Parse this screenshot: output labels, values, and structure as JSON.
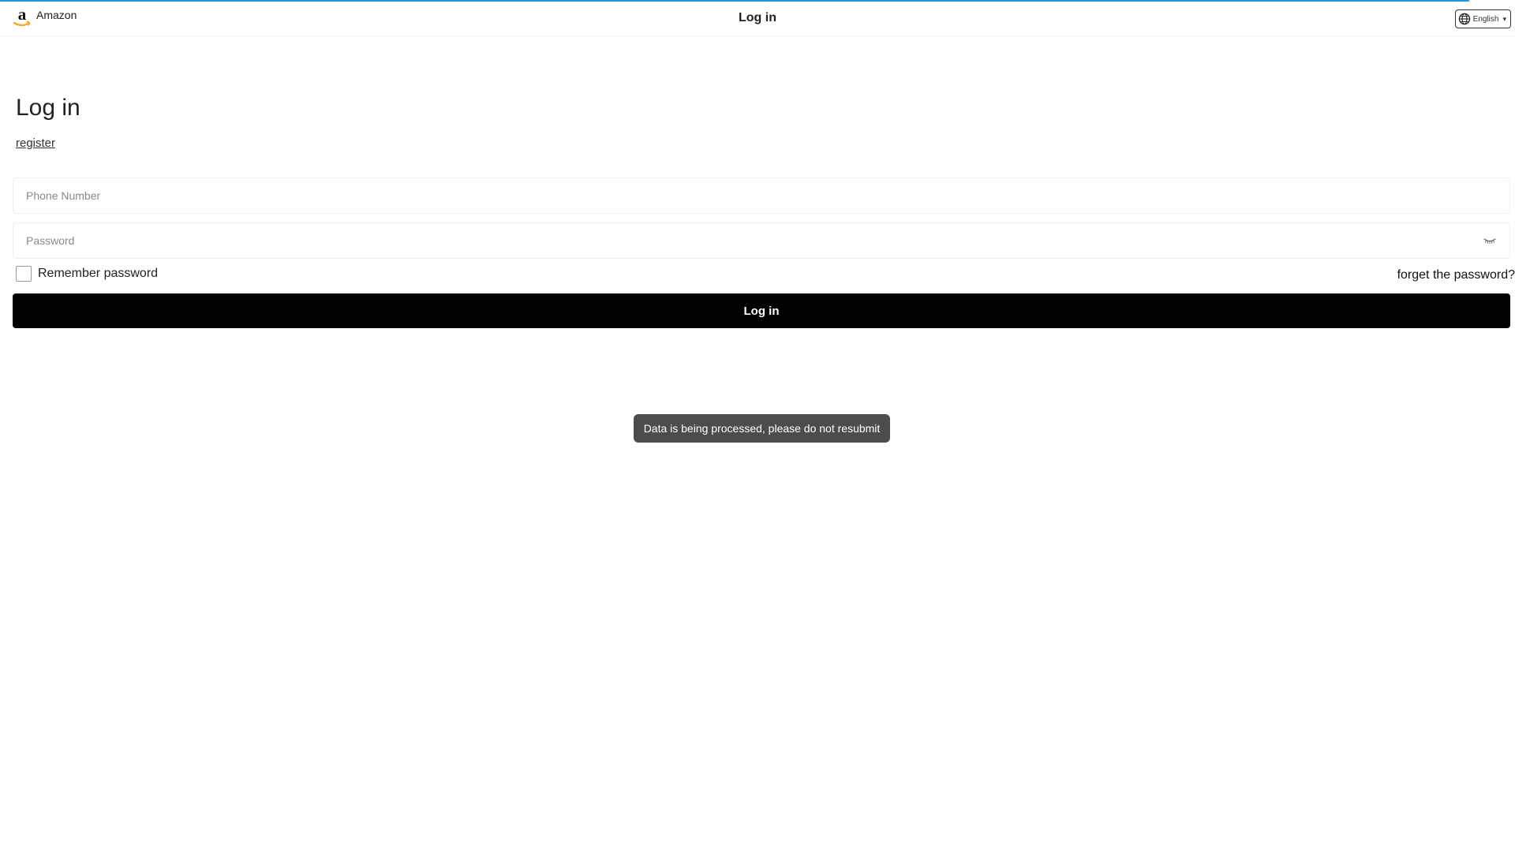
{
  "loading": {
    "progress": 0.97,
    "color": "#1e9be0"
  },
  "header": {
    "brand_name": "Amazon",
    "brand_icon": "amazon-logo-icon",
    "title": "Log in",
    "language": {
      "selected": "English",
      "icon": "globe-icon",
      "caret": "▾"
    }
  },
  "main": {
    "heading": "Log in",
    "register_label": "register",
    "phone": {
      "placeholder": "Phone Number",
      "value": ""
    },
    "password": {
      "placeholder": "Password",
      "value": "",
      "toggle_icon": "eye-closed-icon"
    },
    "remember_label": "Remember password",
    "remember_checked": false,
    "forgot_label": "forget the password?",
    "login_label": "Log in"
  },
  "toast": {
    "message": "Data is being processed, please do not resubmit"
  },
  "colors": {
    "button_bg": "#000000",
    "toast_bg": "#4c4c4c",
    "accent": "#1e9be0",
    "logo_orange": "#f5a623"
  }
}
